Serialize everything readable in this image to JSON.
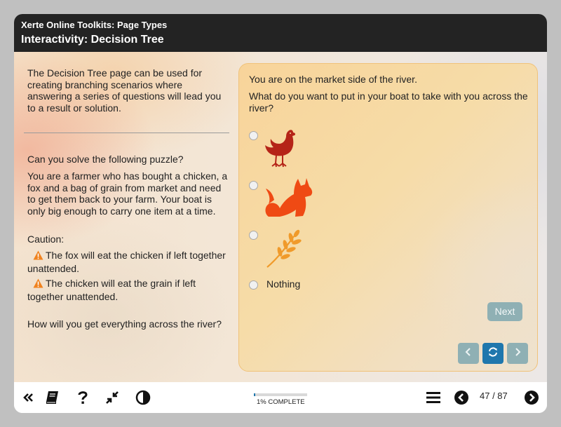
{
  "header": {
    "app_title": "Xerte Online Toolkits: Page Types",
    "page_title": "Interactivity: Decision Tree"
  },
  "left": {
    "intro": "The Decision Tree page can be used for creating branching scenarios where answering a series of questions will lead you to a result or solution.",
    "puzzle_question": "Can you solve the following puzzle?",
    "puzzle_body": "You are a farmer who has bought a chicken, a fox and a bag of grain from market and need to get them back to your farm. Your boat is only big enough to carry one item at a time.",
    "caution_label": "Caution:",
    "warning_1": "The fox will eat the chicken if left together unattended.",
    "warning_2": "The chicken will eat the grain if left together unattended.",
    "final_question": "How will you get everything across the river?",
    "warning_icon": "warning-triangle-icon",
    "warning_color": "#f0821e"
  },
  "question_panel": {
    "location_text": "You are on the market side of the river.",
    "question_text": "What do you want to put in your boat to take with you across the river?",
    "options": [
      {
        "icon": "chicken-icon",
        "color": "#b52418"
      },
      {
        "icon": "fox-icon",
        "color": "#ef4a14"
      },
      {
        "icon": "wheat-icon",
        "color": "#f09a2a"
      },
      {
        "label": "Nothing"
      }
    ],
    "next_label": "Next",
    "nav": [
      "chevron-left-icon",
      "refresh-icon",
      "chevron-right-icon"
    ],
    "accent_color": "#1f77ad"
  },
  "footer": {
    "icons": [
      "double-chevron-left-icon",
      "glossary-book-icon",
      "help-icon",
      "minimize-icon",
      "contrast-icon",
      "menu-icon",
      "previous-page-icon",
      "next-page-icon"
    ],
    "progress_label": "1% COMPLETE",
    "progress_fraction": 0.01,
    "page_counter": "47 / 87"
  }
}
